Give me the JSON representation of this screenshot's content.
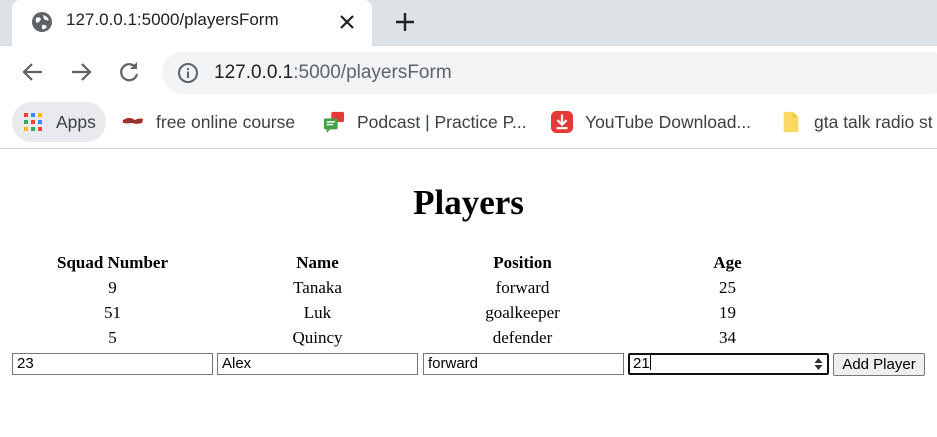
{
  "browser": {
    "tab": {
      "title": "127.0.0.1:5000/playersForm"
    },
    "url": {
      "host": "127.0.0.1",
      "rest": ":5000/playersForm"
    },
    "bookmarks": [
      {
        "label": "Apps",
        "icon": "apps-grid-icon"
      },
      {
        "label": "free online course",
        "icon": "course-bookmark-icon"
      },
      {
        "label": "Podcast | Practice P...",
        "icon": "podcast-bookmark-icon"
      },
      {
        "label": "YouTube Download...",
        "icon": "download-bookmark-icon"
      },
      {
        "label": "gta talk radio st",
        "icon": "folder-icon"
      }
    ]
  },
  "page": {
    "heading": "Players",
    "table": {
      "headers": [
        "Squad Number",
        "Name",
        "Position",
        "Age"
      ],
      "rows": [
        [
          "9",
          "Tanaka",
          "forward",
          "25"
        ],
        [
          "51",
          "Luk",
          "goalkeeper",
          "19"
        ],
        [
          "5",
          "Quincy",
          "defender",
          "34"
        ]
      ]
    },
    "form": {
      "squad_number": "23",
      "name": "Alex",
      "position": "forward",
      "age": "21",
      "submit_label": "Add Player"
    }
  },
  "colors": {
    "tabstrip": "#dee1e6",
    "omnibox": "#f1f3f4",
    "apps_chip": "#e8eaed",
    "youtube_red": "#e53935",
    "folder_yellow": "#f9d863"
  }
}
